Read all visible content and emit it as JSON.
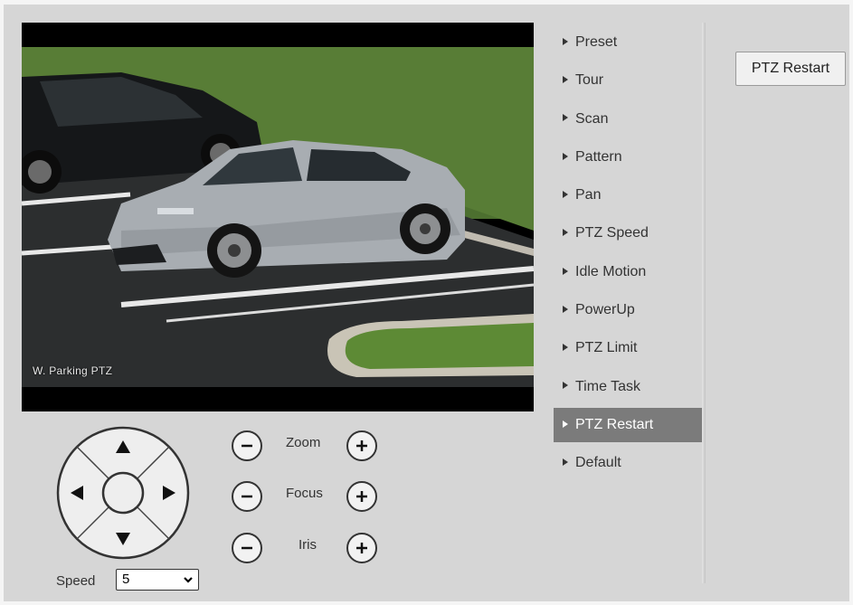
{
  "video": {
    "osd_text": "W. Parking PTZ"
  },
  "ptz": {
    "speed_label": "Speed",
    "speed_value": "5",
    "zoom_label": "Zoom",
    "focus_label": "Focus",
    "iris_label": "Iris"
  },
  "menu": {
    "items": [
      {
        "label": "Preset"
      },
      {
        "label": "Tour"
      },
      {
        "label": "Scan"
      },
      {
        "label": "Pattern"
      },
      {
        "label": "Pan"
      },
      {
        "label": "PTZ Speed"
      },
      {
        "label": "Idle Motion"
      },
      {
        "label": "PowerUp"
      },
      {
        "label": "PTZ Limit"
      },
      {
        "label": "Time Task"
      },
      {
        "label": "PTZ Restart"
      },
      {
        "label": "Default"
      }
    ],
    "active": "PTZ Restart"
  },
  "content": {
    "restart_button": "PTZ Restart"
  },
  "colors": {
    "panel_bg": "#d6d6d6",
    "active_menu_bg": "#7b7b7b"
  }
}
